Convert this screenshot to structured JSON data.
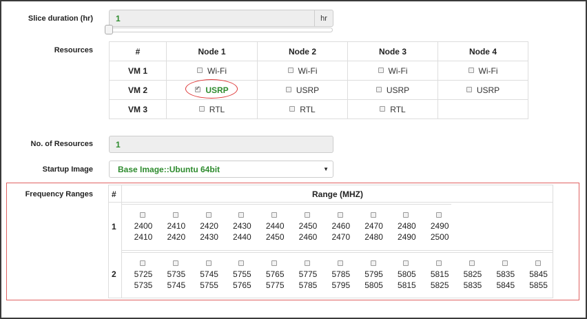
{
  "slice": {
    "label": "Slice duration (hr)",
    "value": "1",
    "unit": "hr",
    "slider_level": 0
  },
  "resources": {
    "label": "Resources",
    "header": [
      "#",
      "Node 1",
      "Node 2",
      "Node 3",
      "Node 4"
    ],
    "rows": [
      {
        "vm": "VM 1",
        "cells": [
          {
            "label": "Wi-Fi",
            "checked": false
          },
          {
            "label": "Wi-Fi",
            "checked": false
          },
          {
            "label": "Wi-Fi",
            "checked": false
          },
          {
            "label": "Wi-Fi",
            "checked": false
          }
        ]
      },
      {
        "vm": "VM 2",
        "cells": [
          {
            "label": "USRP",
            "checked": true
          },
          {
            "label": "USRP",
            "checked": false
          },
          {
            "label": "USRP",
            "checked": false
          },
          {
            "label": "USRP",
            "checked": false
          }
        ]
      },
      {
        "vm": "VM 3",
        "cells": [
          {
            "label": "RTL",
            "checked": false
          },
          {
            "label": "RTL",
            "checked": false
          },
          {
            "label": "RTL",
            "checked": false
          },
          null
        ]
      }
    ]
  },
  "num_resources": {
    "label": "No. of Resources",
    "value": "1"
  },
  "startup_image": {
    "label": "Startup Image",
    "selected": "Base Image::Ubuntu 64bit"
  },
  "frequency": {
    "label": "Frequency Ranges",
    "col_hash": "#",
    "col_range": "Range (MHZ)",
    "rows": [
      {
        "num": "1",
        "ranges": [
          [
            "2400",
            "2410"
          ],
          [
            "2410",
            "2420"
          ],
          [
            "2420",
            "2430"
          ],
          [
            "2430",
            "2440"
          ],
          [
            "2440",
            "2450"
          ],
          [
            "2450",
            "2460"
          ],
          [
            "2460",
            "2470"
          ],
          [
            "2470",
            "2480"
          ],
          [
            "2480",
            "2490"
          ],
          [
            "2490",
            "2500"
          ]
        ]
      },
      {
        "num": "2",
        "ranges": [
          [
            "5725",
            "5735"
          ],
          [
            "5735",
            "5745"
          ],
          [
            "5745",
            "5755"
          ],
          [
            "5755",
            "5765"
          ],
          [
            "5765",
            "5775"
          ],
          [
            "5775",
            "5785"
          ],
          [
            "5785",
            "5795"
          ],
          [
            "5795",
            "5805"
          ],
          [
            "5805",
            "5815"
          ],
          [
            "5815",
            "5825"
          ],
          [
            "5825",
            "5835"
          ],
          [
            "5835",
            "5845"
          ],
          [
            "5845",
            "5855"
          ]
        ]
      }
    ]
  },
  "colors": {
    "value_green": "#2e8b2e",
    "highlight_red": "#d33333"
  }
}
